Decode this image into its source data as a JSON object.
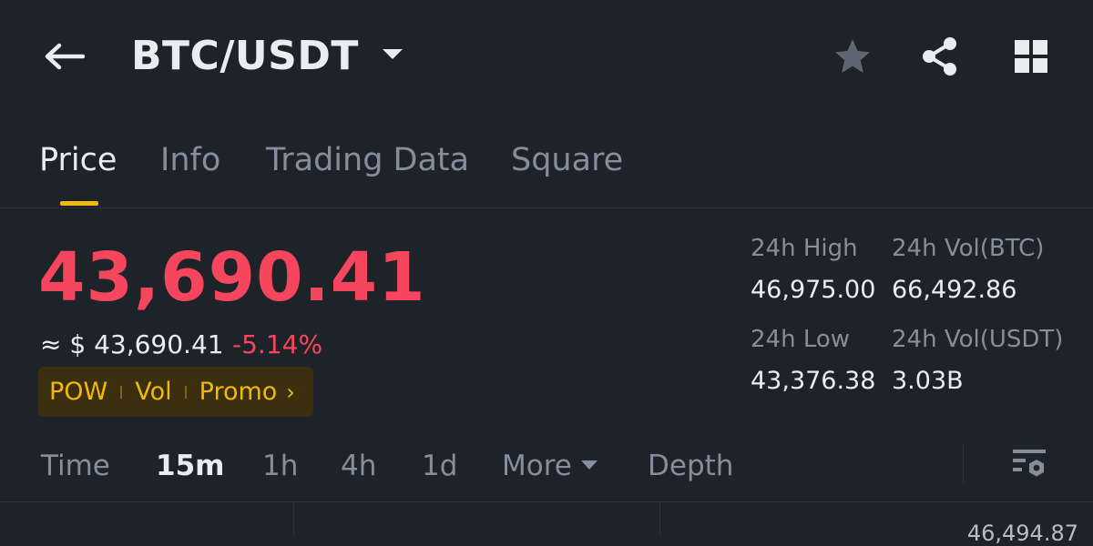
{
  "header": {
    "pair": "BTC/USDT"
  },
  "tabs": [
    {
      "label": "Price",
      "active": true
    },
    {
      "label": "Info"
    },
    {
      "label": "Trading Data"
    },
    {
      "label": "Square"
    }
  ],
  "price": {
    "last": "43,690.41",
    "approx": "≈ $ 43,690.41",
    "change": "-5.14%"
  },
  "tags": [
    "POW",
    "Vol",
    "Promo"
  ],
  "stats": {
    "high_label": "24h High",
    "high_value": "46,975.00",
    "vol_btc_label": "24h Vol(BTC)",
    "vol_btc_value": "66,492.86",
    "low_label": "24h Low",
    "low_value": "43,376.38",
    "vol_usdt_label": "24h Vol(USDT)",
    "vol_usdt_value": "3.03B"
  },
  "timeframes": {
    "time": "Time",
    "m15": "15m",
    "h1": "1h",
    "h4": "4h",
    "d1": "1d",
    "more": "More",
    "depth": "Depth"
  },
  "chart": {
    "top_price_label": "46,494.87"
  },
  "colors": {
    "background": "#1e2329",
    "down_red": "#f6465d",
    "accent_yellow": "#f0b90b"
  },
  "icons": [
    "back-arrow-icon",
    "dropdown-caret-icon",
    "star-icon",
    "share-icon",
    "grid-icon",
    "chart-settings-icon"
  ]
}
